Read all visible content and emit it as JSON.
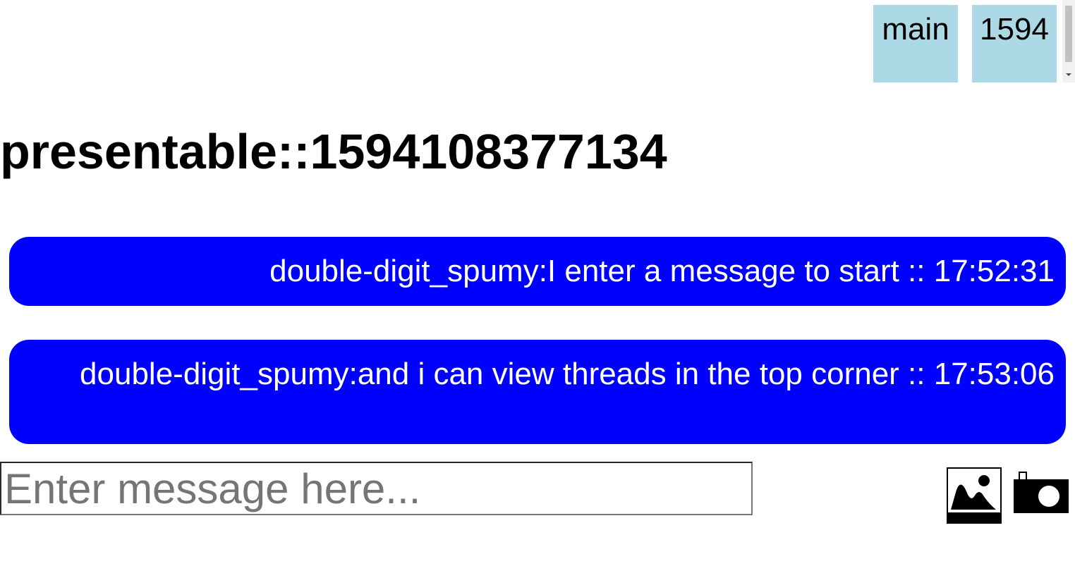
{
  "threads": {
    "items": [
      {
        "label": "main"
      },
      {
        "label": "1594"
      }
    ]
  },
  "room": {
    "title": "presentable::1594108377134"
  },
  "messages": [
    {
      "text": "double-digit_spumy:I enter a message to start :: 17:52:31"
    },
    {
      "text": "double-digit_spumy:and i can view threads in the top corner :: 17:53:06"
    }
  ],
  "composer": {
    "placeholder": "Enter message here...",
    "value": ""
  },
  "icons": {
    "image_upload": "image-icon",
    "camera": "camera-icon"
  },
  "colors": {
    "thread_tab_bg": "#add8e6",
    "message_bg": "#0000ff",
    "message_text": "#ffffff"
  }
}
